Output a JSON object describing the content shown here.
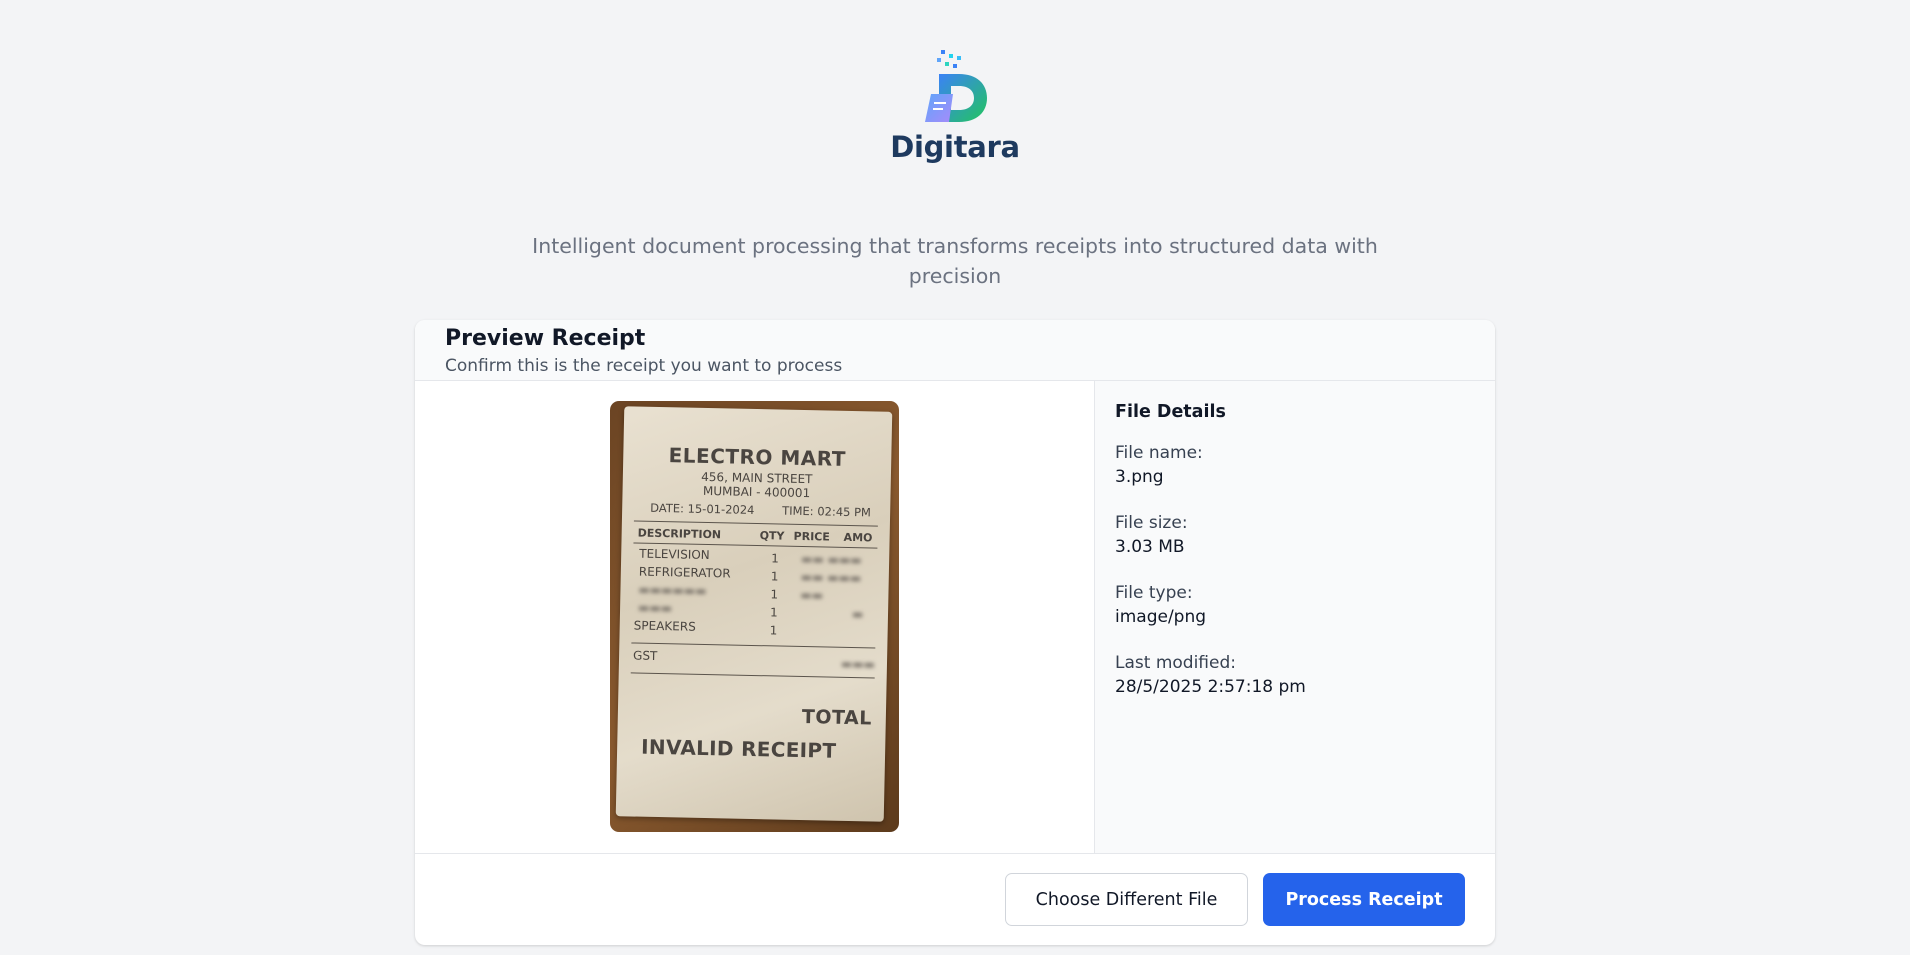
{
  "brand": {
    "name": "Digitara",
    "logo": "digitara-logo-icon"
  },
  "tagline": "Intelligent document processing that transforms receipts into structured data with precision",
  "card": {
    "title": "Preview Receipt",
    "subtitle": "Confirm this is the receipt you want to process"
  },
  "receipt": {
    "store": "ELECTRO MART",
    "address1": "456, MAIN STREET",
    "address2": "MUMBAI - 400001",
    "date": "DATE: 15-01-2024",
    "time": "TIME: 02:45 PM",
    "columns": [
      "DESCRIPTION",
      "QTY",
      "PRICE",
      "AMO"
    ],
    "items": [
      {
        "description": "TELEVISION",
        "qty": "1"
      },
      {
        "description": "REFRIGERATOR",
        "qty": "1"
      },
      {
        "description": "",
        "qty": "1"
      },
      {
        "description": "",
        "qty": "1"
      },
      {
        "description": "SPEAKERS",
        "qty": "1"
      }
    ],
    "tax_label": "GST",
    "total_label": "TOTAL",
    "stamp": "INVALID RECEIPT"
  },
  "details": {
    "heading": "File Details",
    "fields": [
      {
        "label": "File name:",
        "value": "3.png"
      },
      {
        "label": "File size:",
        "value": "3.03 MB"
      },
      {
        "label": "File type:",
        "value": "image/png"
      },
      {
        "label": "Last modified:",
        "value": "28/5/2025 2:57:18 pm"
      }
    ]
  },
  "actions": {
    "choose_label": "Choose Different File",
    "process_label": "Process Receipt"
  },
  "colors": {
    "primary": "#2563eb",
    "background": "#f3f4f6",
    "brand_text": "#1e3a5f"
  }
}
